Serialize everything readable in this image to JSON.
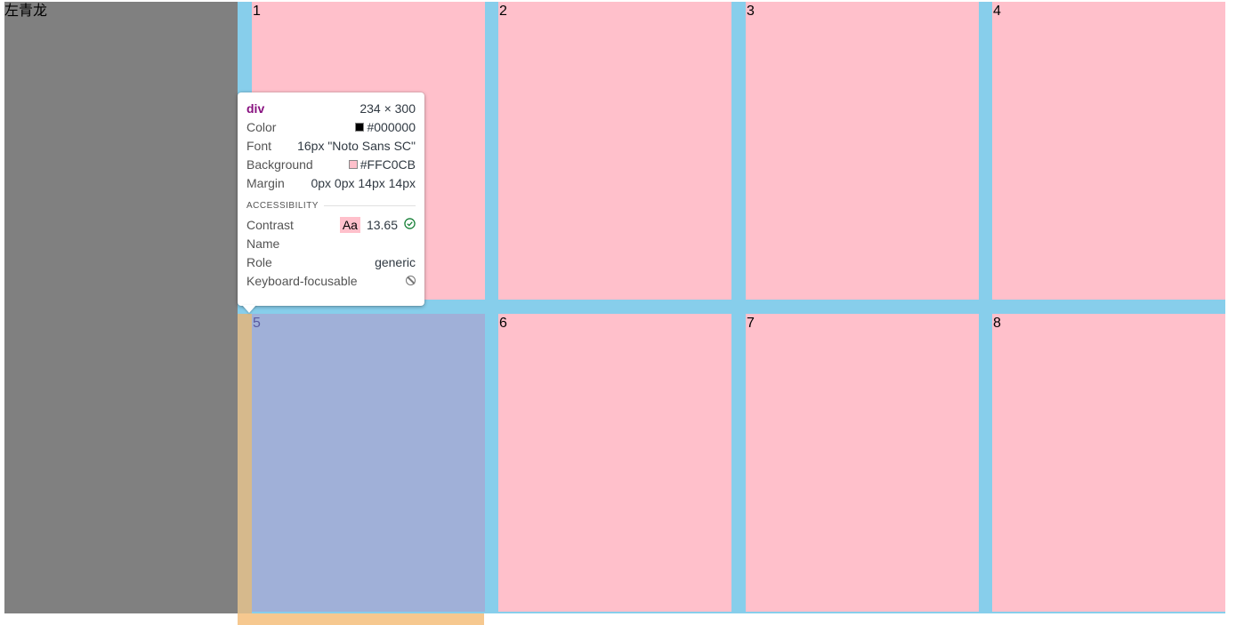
{
  "left_panel": {
    "label": "左青龙"
  },
  "grid": {
    "cells": [
      "1",
      "2",
      "3",
      "4",
      "5",
      "6",
      "7",
      "8"
    ]
  },
  "tooltip": {
    "tag": "div",
    "dimensions": "234 × 300",
    "rows": {
      "color": {
        "label": "Color",
        "value": "#000000",
        "swatch": "#000000"
      },
      "font": {
        "label": "Font",
        "value": "16px \"Noto Sans SC\""
      },
      "background": {
        "label": "Background",
        "value": "#FFC0CB",
        "swatch": "#ffc0cb"
      },
      "margin": {
        "label": "Margin",
        "value": "0px 0px 14px 14px"
      }
    },
    "accessibility": {
      "heading": "ACCESSIBILITY",
      "contrast_label": "Contrast",
      "contrast_badge": "Aa",
      "contrast_value": "13.65",
      "name_label": "Name",
      "role_label": "Role",
      "role_value": "generic",
      "focusable_label": "Keyboard-focusable"
    }
  },
  "colors": {
    "grid_background": "#87ceeb",
    "cell_background": "#ffc0cb",
    "left_panel_background": "#808080",
    "highlight_overlay": "#a0b0d8",
    "margin_overlay": "#f6c88f"
  }
}
